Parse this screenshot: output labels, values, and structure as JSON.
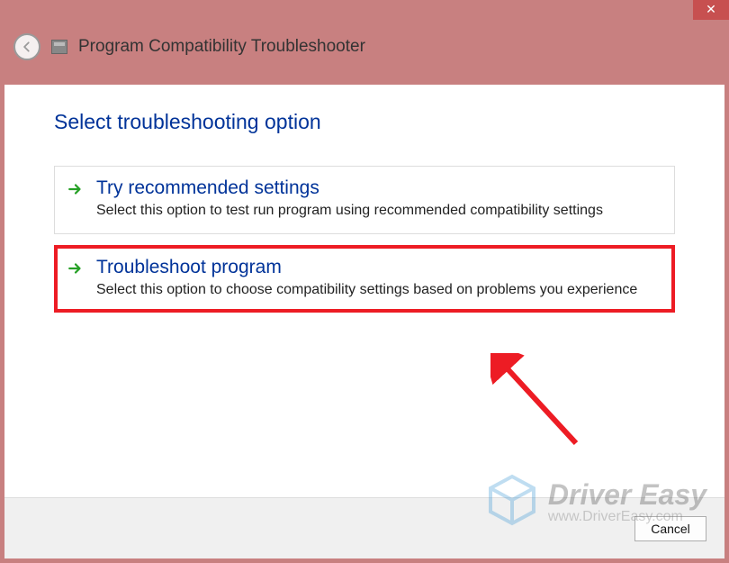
{
  "header": {
    "title": "Program Compatibility Troubleshooter"
  },
  "heading": "Select troubleshooting option",
  "options": [
    {
      "title": "Try recommended settings",
      "desc": "Select this option to test run program using recommended compatibility settings"
    },
    {
      "title": "Troubleshoot program",
      "desc": "Select this option to choose compatibility settings based on problems you experience"
    }
  ],
  "footer": {
    "cancel": "Cancel"
  },
  "watermark": {
    "brand": "Driver Easy",
    "url": "www.DriverEasy.com"
  },
  "close_glyph": "✕"
}
